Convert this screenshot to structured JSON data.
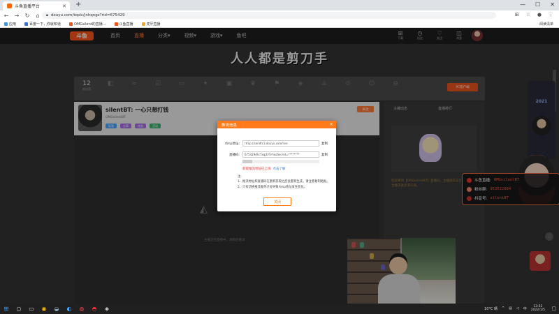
{
  "browser": {
    "tab_title": "斗鱼直播平台",
    "url": "douyu.com/topic/jnhqngz?rid=675429",
    "bookmarks": [
      {
        "label": "应用",
        "color": "#4a90e2"
      },
      {
        "label": "百度一下，你就知道",
        "color": "#2f6fe0"
      },
      {
        "label": "OMGsilent的直播...",
        "color": "#f7541a"
      },
      {
        "label": "斗鱼直播",
        "color": "#f7541a"
      },
      {
        "label": "虎牙直播",
        "color": "#f5a623"
      }
    ],
    "reading_list": "阅读清单"
  },
  "site": {
    "logo": "斗鱼",
    "nav": [
      {
        "label": "首页",
        "active": false
      },
      {
        "label": "直播",
        "active": true
      },
      {
        "label": "分类▾",
        "active": false
      },
      {
        "label": "视频▾",
        "active": false
      },
      {
        "label": "游戏▾",
        "active": false
      },
      {
        "label": "鱼吧",
        "active": false
      }
    ],
    "header_icons": [
      {
        "icon": "gift-icon",
        "glyph": "⊞",
        "label": "下载"
      },
      {
        "icon": "clock-icon",
        "glyph": "◷",
        "label": "历史"
      },
      {
        "icon": "heart-icon",
        "glyph": "♡",
        "label": "关注"
      },
      {
        "icon": "bell-icon",
        "glyph": "◫",
        "label": "消息"
      },
      {
        "icon": "cart-icon",
        "glyph": "⌂",
        "label": "任务"
      }
    ]
  },
  "banner": {
    "title": "人人都是剪刀手"
  },
  "gift_strip": {
    "count": "12",
    "count_label": "粉丝团",
    "items": [
      {
        "icon": "gift-icon",
        "glyph": "◧"
      },
      {
        "icon": "wave-icon",
        "glyph": "≈"
      },
      {
        "icon": "check-icon",
        "glyph": "☑"
      },
      {
        "icon": "card-icon",
        "glyph": "▭"
      },
      {
        "icon": "star-icon",
        "glyph": "✦"
      },
      {
        "icon": "box-icon",
        "glyph": "▣"
      },
      {
        "icon": "trophy-icon",
        "glyph": "♛"
      },
      {
        "icon": "flag-icon",
        "glyph": "⚑"
      },
      {
        "icon": "cube-icon",
        "glyph": "◈"
      },
      {
        "icon": "rocket-icon",
        "glyph": "⟁"
      },
      {
        "icon": "crown-icon",
        "glyph": "♔"
      },
      {
        "icon": "emoji-icon",
        "glyph": "☺"
      },
      {
        "icon": "more-icon",
        "glyph": "⊖"
      }
    ],
    "pc_button": "PC客户端"
  },
  "room": {
    "title": "silentBT: 一心只想打钱",
    "meta": "OMGsilentBT",
    "tags": [
      {
        "label": "标签",
        "color": "#4aa3ff"
      },
      {
        "label": "分享",
        "color": "#a66ee6"
      },
      {
        "label": "任务",
        "color": "#a66ee6"
      },
      {
        "label": "活动",
        "color": "#3cb371"
      }
    ],
    "follow": "关注",
    "play_hint": "主播正在直播中，请稍后重试"
  },
  "side": {
    "tab_a": "主播动态",
    "tab_b": "直播排行",
    "text": "欢迎来到【OMGsilentBT】直播间，主播现在正在直播中，新主播求关注求订阅。"
  },
  "overlay": {
    "rows": [
      {
        "label": "斗鱼直播:",
        "value": "OMGsilentBT"
      },
      {
        "label": "粉丝群:",
        "value": "953522084"
      },
      {
        "label": "抖音号:",
        "value": "silentBT"
      }
    ],
    "badge_year": "2021"
  },
  "modal": {
    "title": "推流信息",
    "close": "×",
    "rtmp_label": "rtmp地址:",
    "rtmp_value": "rtmp://sendtc3.douyu.com/live",
    "key_label": "直播码:",
    "key_value": "675429rBc7xqj1Ffv?wsSecret=********",
    "copy": "复制",
    "warning": "获取推流地址已上线",
    "warning_link": "点击了解",
    "notes_title": "注:",
    "note1": "1、推流地址和直播码在重新获取之后会重新生成，请注意复制粘贴。",
    "note2": "2、只有切换推流服务才会导致rtmp地址发生变化。",
    "ok": "关闭"
  },
  "taskbar": {
    "weather": "10°C 晴",
    "time": "13:52",
    "date": "2022/1/5",
    "lang": "中"
  }
}
